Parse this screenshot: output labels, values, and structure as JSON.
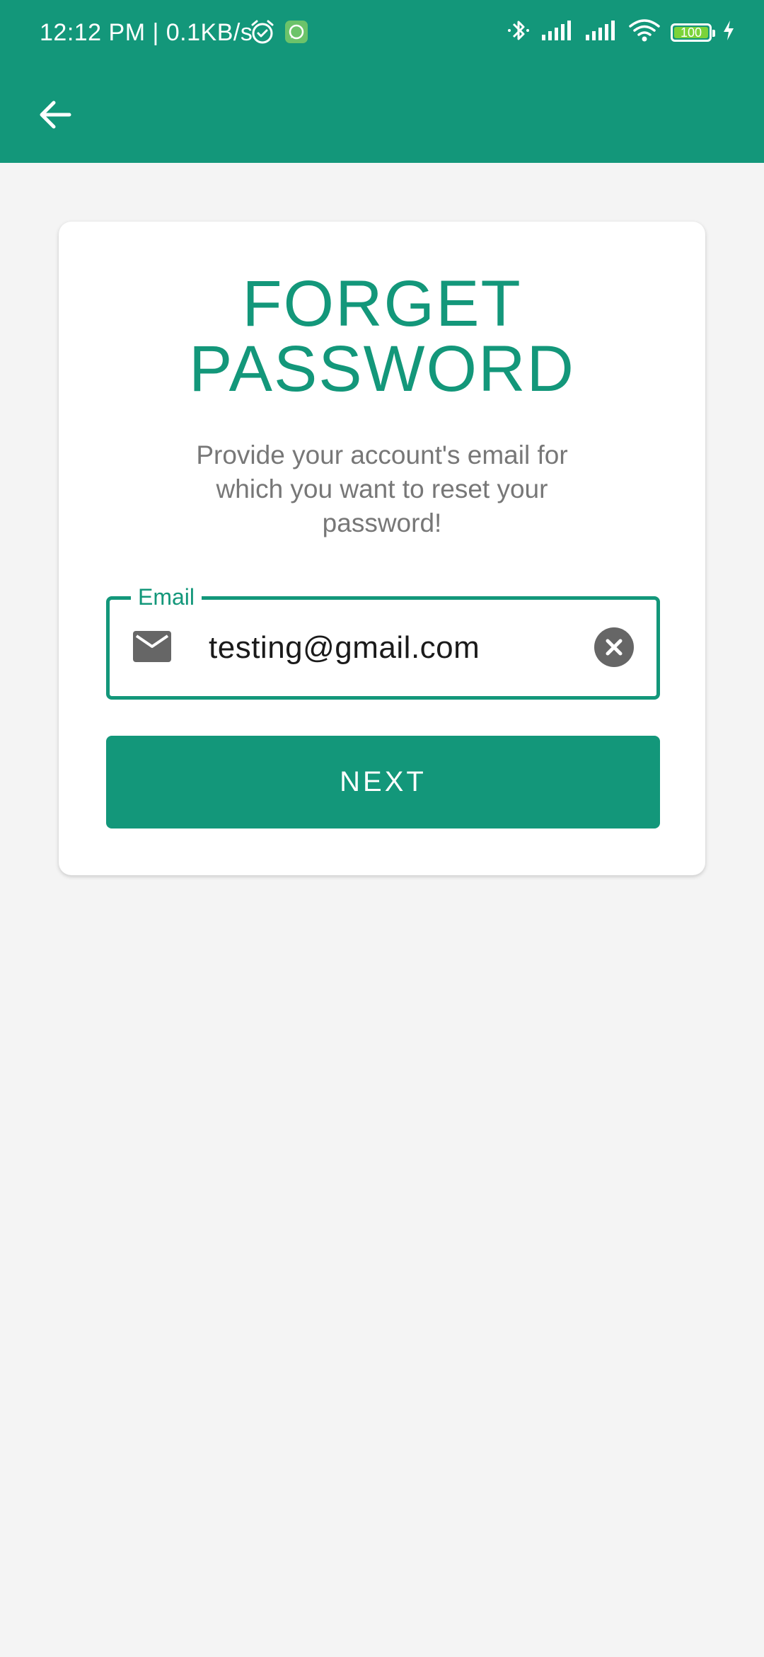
{
  "status_bar": {
    "time_text": "12:12 PM | 0.1KB/s",
    "battery_level": "100",
    "icons": [
      "alarm-icon",
      "whatsapp-icon",
      "bluetooth-icon",
      "signal-icon",
      "signal-icon",
      "wifi-icon",
      "battery-icon",
      "charging-icon"
    ]
  },
  "app_bar": {
    "back_icon": "arrow-left-icon"
  },
  "forgot_password": {
    "title_line1": "FORGET",
    "title_line2": "PASSWORD",
    "description": "Provide your account's email for which you want to reset your password!",
    "email_label": "Email",
    "email_value": "testing@gmail.com",
    "email_icon": "mail-icon",
    "clear_icon": "clear-icon",
    "next_label": "NEXT"
  },
  "colors": {
    "primary": "#13977a",
    "background": "#f4f4f4",
    "card": "#ffffff",
    "muted_text": "#777777",
    "icon_gray": "#666666",
    "battery_fill": "#7bd339"
  }
}
